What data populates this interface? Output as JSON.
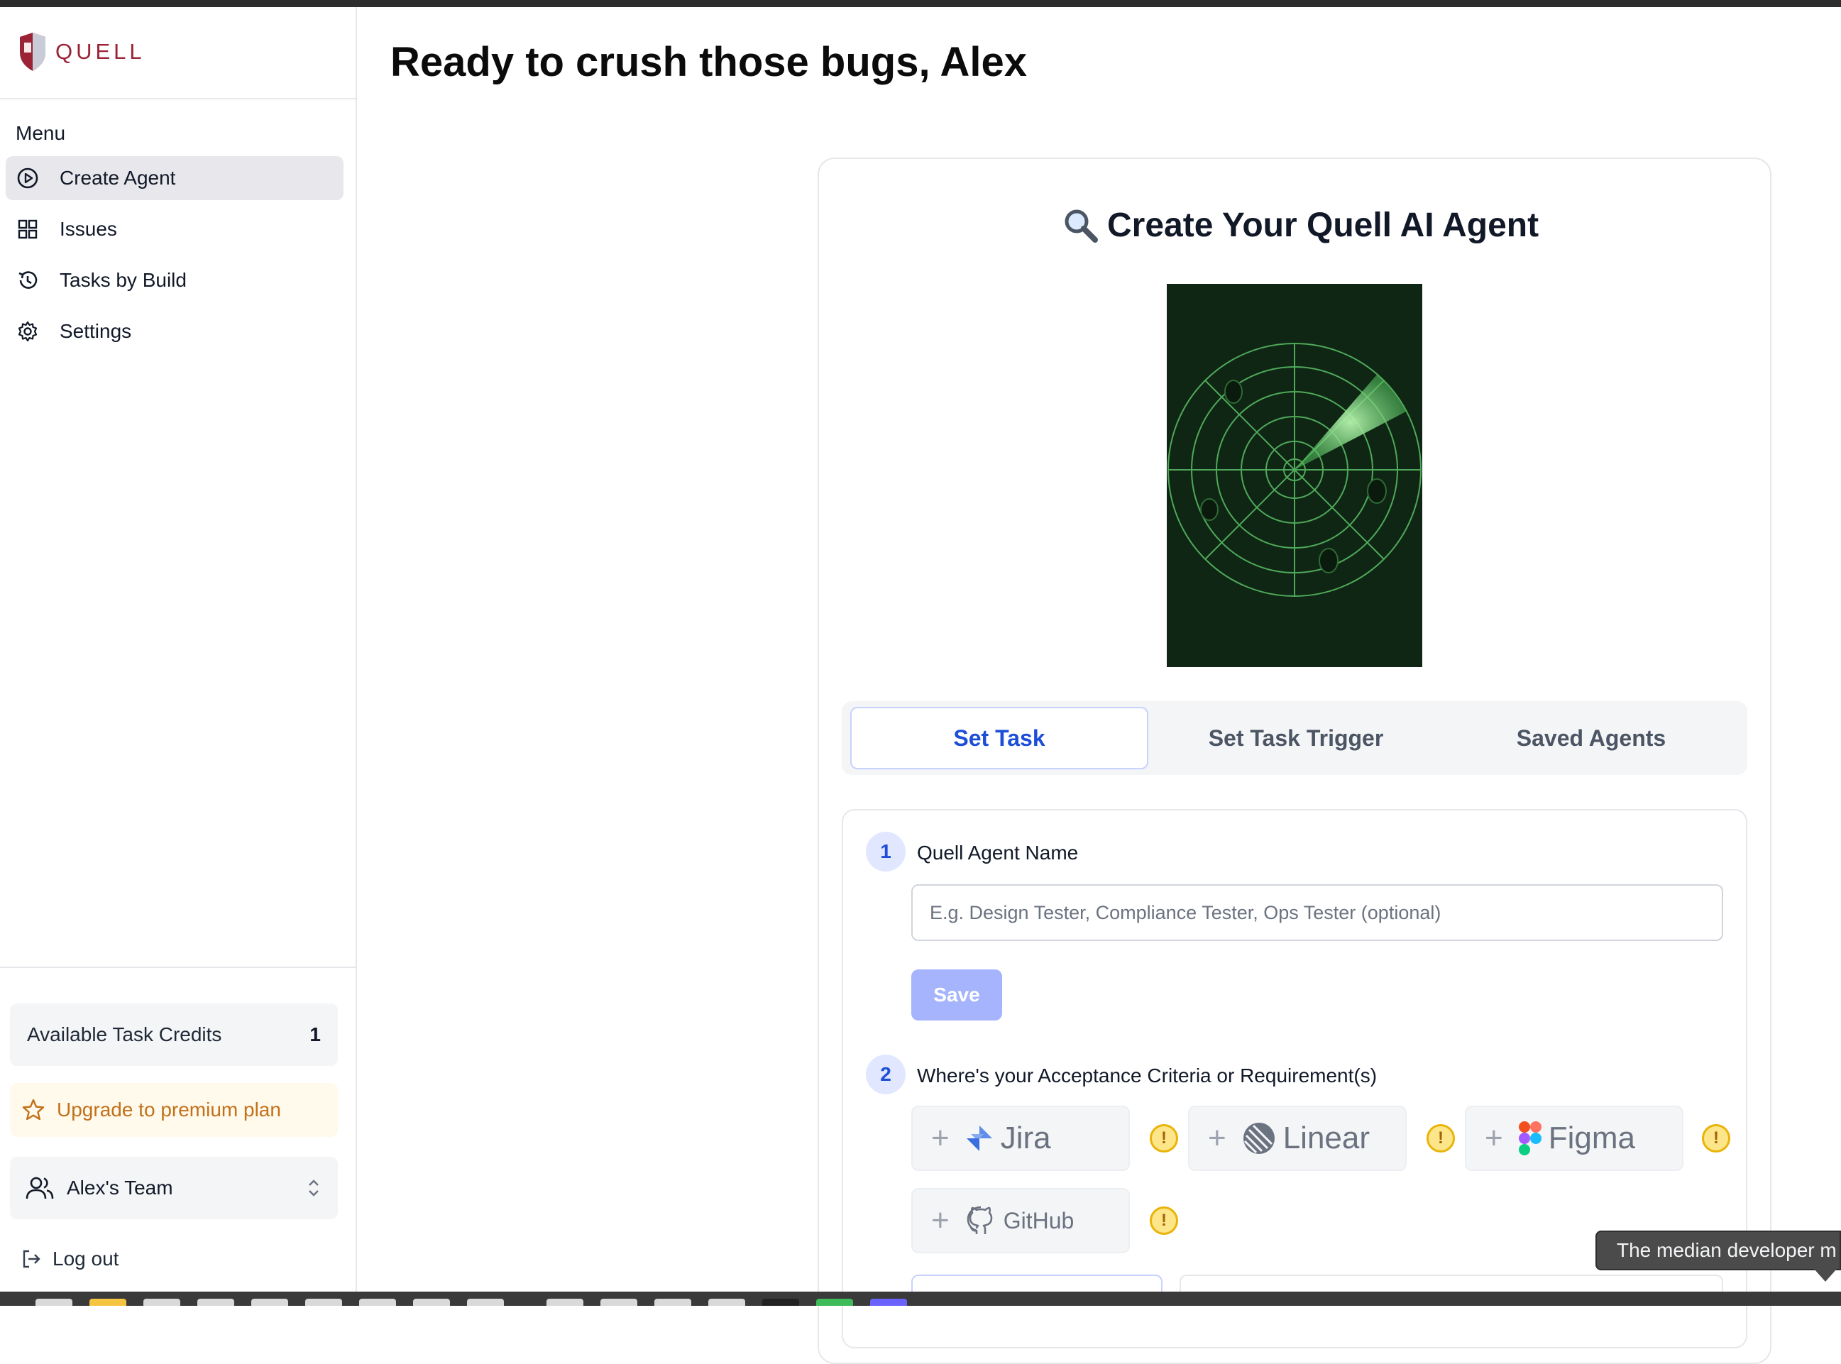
{
  "app": {
    "logo_text": "QUELL",
    "brand_color": "#9b2335"
  },
  "sidebar": {
    "menu_title": "Menu",
    "items": [
      {
        "label": "Create Agent",
        "icon": "play-circle-icon",
        "active": true
      },
      {
        "label": "Issues",
        "icon": "grid-icon",
        "active": false
      },
      {
        "label": "Tasks by Build",
        "icon": "history-icon",
        "active": false
      },
      {
        "label": "Settings",
        "icon": "gear-icon",
        "active": false
      }
    ],
    "credits_label": "Available Task Credits",
    "credits_value": "1",
    "upgrade_label": "Upgrade to premium plan",
    "team_label": "Alex's Team",
    "logout_label": "Log out"
  },
  "main": {
    "greeting": "Ready to crush those bugs, Alex",
    "card_title": "Create Your Quell AI Agent",
    "card_title_icon": "magnifier-icon",
    "tabs": [
      {
        "label": "Set Task",
        "active": true
      },
      {
        "label": "Set Task Trigger",
        "active": false
      },
      {
        "label": "Saved Agents",
        "active": false
      }
    ],
    "step1": {
      "number": "1",
      "label": "Quell Agent Name",
      "placeholder": "E.g. Design Tester, Compliance Tester, Ops Tester (optional)",
      "value": "",
      "save_label": "Save"
    },
    "step2": {
      "number": "2",
      "label": "Where's your Acceptance Criteria or Requirement(s)",
      "integrations": [
        {
          "name": "Jira",
          "icon": "jira-icon"
        },
        {
          "name": "Linear",
          "icon": "linear-icon"
        },
        {
          "name": "Figma",
          "icon": "figma-icon"
        },
        {
          "name": "GitHub",
          "icon": "github-icon"
        }
      ],
      "warning_glyph": "!"
    },
    "tooltip": "The median developer m"
  },
  "colors": {
    "accent": "#1d4ed8",
    "save_disabled": "#a5b4fc",
    "upgrade_text": "#c2701a",
    "radar_bg": "#0f2614",
    "radar_green": "#6ddc7a"
  }
}
